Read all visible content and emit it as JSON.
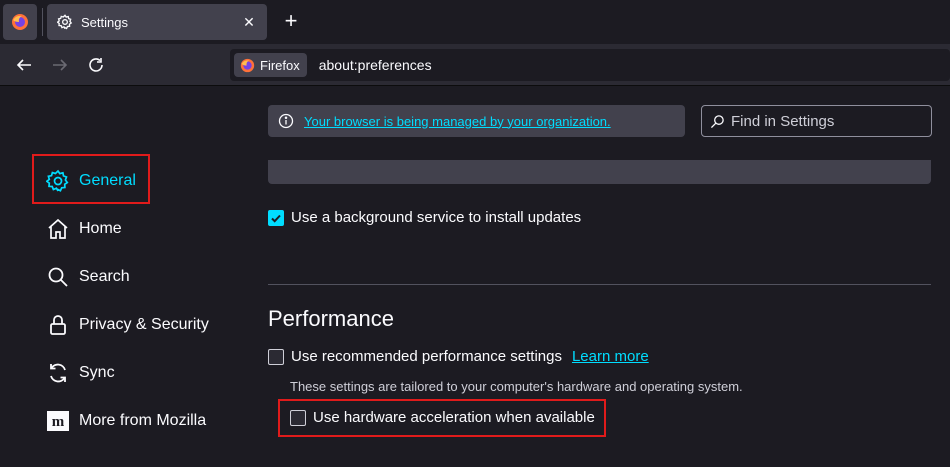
{
  "tab": {
    "title": "Settings",
    "close": "✕"
  },
  "newtab": "+",
  "urlbar": {
    "identity": "Firefox",
    "url": "about:preferences"
  },
  "sidebar": {
    "items": [
      {
        "label": "General"
      },
      {
        "label": "Home"
      },
      {
        "label": "Search"
      },
      {
        "label": "Privacy & Security"
      },
      {
        "label": "Sync"
      },
      {
        "label": "More from Mozilla"
      }
    ]
  },
  "managed": {
    "text": "Your browser is being managed by your organization."
  },
  "find": {
    "placeholder": "Find in Settings"
  },
  "updates": {
    "label": "Use a background service to install updates",
    "checked": true
  },
  "performance": {
    "heading": "Performance",
    "recommended_label": "Use recommended performance settings",
    "learn_more": "Learn more",
    "description": "These settings are tailored to your computer's hardware and operating system.",
    "hw_label": "Use hardware acceleration when available"
  },
  "colors": {
    "accent": "#00ddff",
    "highlight": "#e01b1b",
    "background": "#1c1b22"
  }
}
